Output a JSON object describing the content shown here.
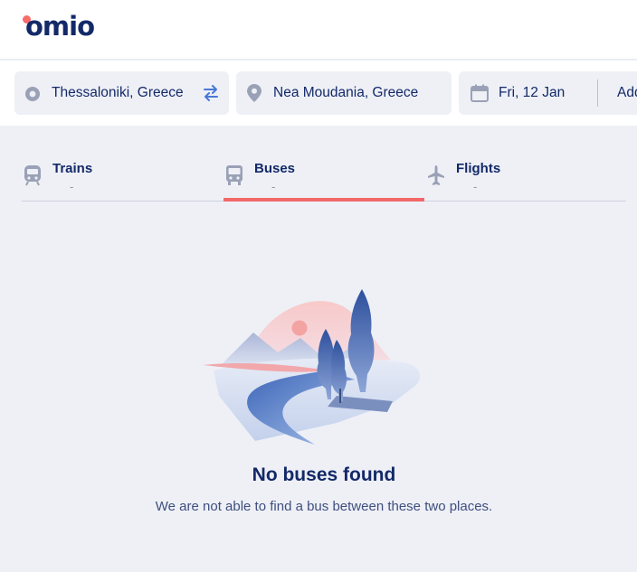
{
  "brand": {
    "logo_text": "omio",
    "accent": "#fa6b6b",
    "navy": "#132968"
  },
  "search": {
    "from": "Thessaloniki, Greece",
    "to": "Nea Moudania, Greece",
    "date": "Fri, 12 Jan",
    "return_label": "Add",
    "icons": {
      "from": "origin-dot-icon",
      "swap": "swap-arrows-icon",
      "to": "location-pin-icon",
      "date": "calendar-icon"
    }
  },
  "tabs": [
    {
      "label": "Trains",
      "price": "-",
      "icon": "train-icon",
      "active": false
    },
    {
      "label": "Buses",
      "price": "-",
      "icon": "bus-icon",
      "active": true
    },
    {
      "label": "Flights",
      "price": "-",
      "icon": "plane-icon",
      "active": false
    }
  ],
  "empty_state": {
    "title": "No buses found",
    "message": "We are not able to find a bus between these two places.",
    "illustration": "landscape-illustration"
  }
}
